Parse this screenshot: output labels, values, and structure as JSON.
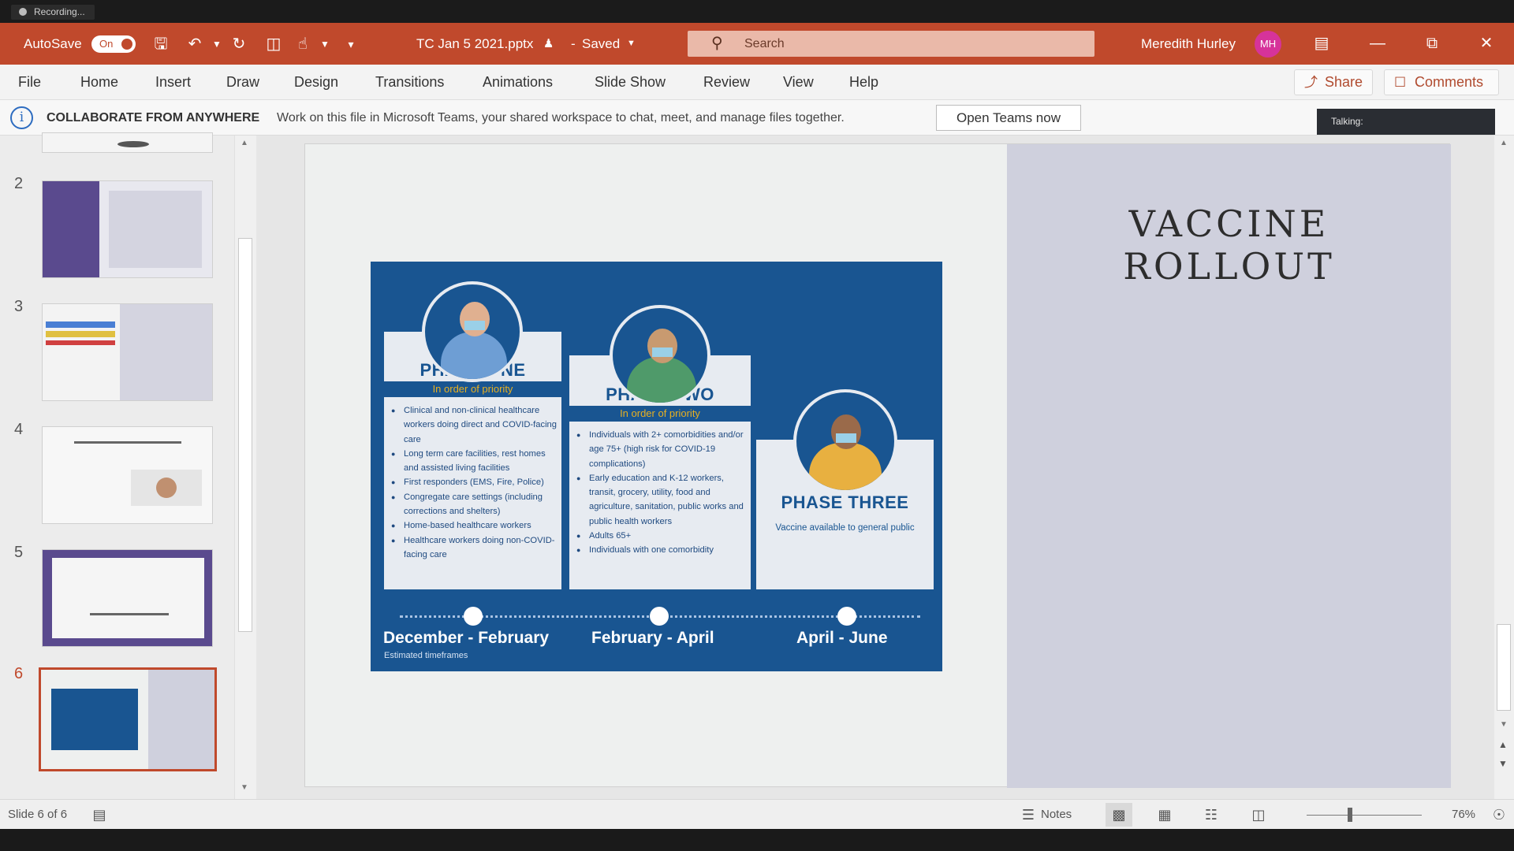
{
  "recording": {
    "label": "Recording..."
  },
  "titlebar": {
    "autosave_label": "AutoSave",
    "autosave_state": "On",
    "filename": "TC Jan 5 2021.pptx",
    "save_status": "Saved",
    "search_placeholder": "Search",
    "user_name": "Meredith Hurley",
    "user_initials": "MH",
    "accent": "#c0492c"
  },
  "ribbon": {
    "tabs": [
      "File",
      "Home",
      "Insert",
      "Draw",
      "Design",
      "Transitions",
      "Animations",
      "Slide Show",
      "Review",
      "View",
      "Help"
    ],
    "share_label": "Share",
    "comments_label": "Comments"
  },
  "message_bar": {
    "title": "COLLABORATE FROM ANYWHERE",
    "text": "Work on this file in Microsoft Teams, your shared workspace to chat, meet, and manage files together.",
    "button": "Open Teams now"
  },
  "talking": {
    "label": "Talking:"
  },
  "thumbnails": [
    {
      "number": "2"
    },
    {
      "number": "3"
    },
    {
      "number": "4"
    },
    {
      "number": "5"
    },
    {
      "number": "6",
      "selected": true
    }
  ],
  "slide": {
    "title": "VACCINE\nROLLOUT",
    "infographic": {
      "phases": [
        {
          "name": "PHASE ONE",
          "subtitle": "In order of priority",
          "items": [
            "Clinical and non-clinical healthcare workers doing direct and COVID-facing care",
            "Long term care facilities, rest homes and assisted living facilities",
            "First responders (EMS, Fire, Police)",
            "Congregate care settings (including corrections and shelters)",
            "Home-based healthcare workers",
            "Healthcare workers doing non-COVID-facing care"
          ],
          "timeframe": "December - February",
          "note": "Estimated timeframes"
        },
        {
          "name": "PHASE TWO",
          "subtitle": "In order of priority",
          "items": [
            "Individuals with 2+ comorbidities and/or age 75+ (high risk for COVID-19 complications)",
            "Early education and K-12 workers, transit, grocery, utility, food and agriculture, sanitation, public works and public health workers",
            "Adults 65+",
            "Individuals with one comorbidity"
          ],
          "timeframe": "February - April"
        },
        {
          "name": "PHASE THREE",
          "subtitle": "Vaccine available to general public",
          "items": [],
          "timeframe": "April - June"
        }
      ]
    }
  },
  "statusbar": {
    "slide_counter": "Slide 6 of 6",
    "notes_label": "Notes",
    "zoom": "76%"
  }
}
